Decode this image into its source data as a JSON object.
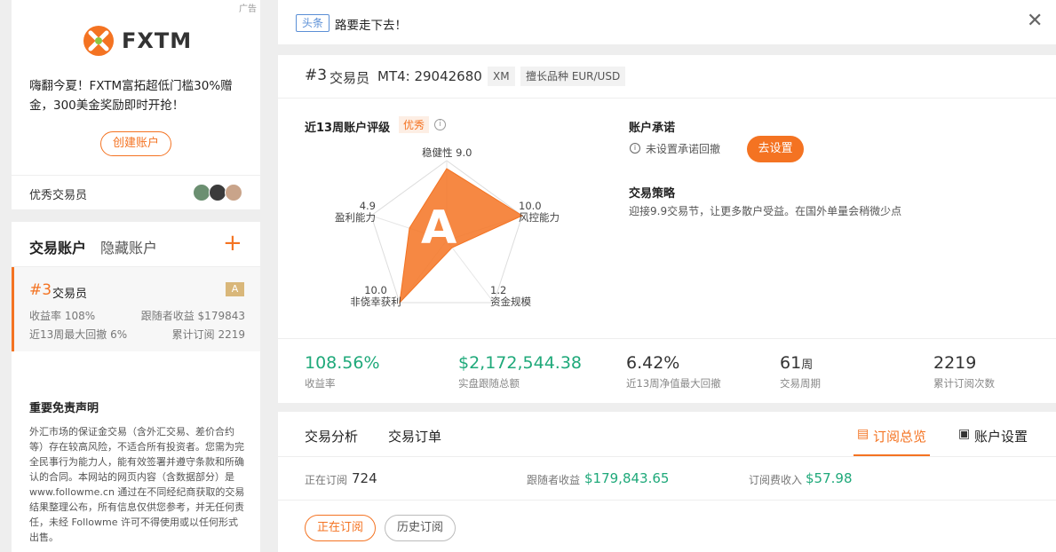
{
  "ad": {
    "badge": "广告",
    "brand": "FXTM",
    "text": "嗨翻今夏！FXTM富拓超低门槛30%赠金，300美金奖励即时开抢！",
    "cta": "创建账户"
  },
  "top_traders": {
    "label": "优秀交易员"
  },
  "accounts": {
    "tab_trading": "交易账户",
    "tab_hidden": "隐藏账户",
    "add_icon": "plus-icon",
    "item": {
      "rank": "#3",
      "name": "交易员",
      "grade": "A",
      "return_label": "收益率 108%",
      "follower_profit": "跟随者收益 $179843",
      "max_drawdown": "近13周最大回撤 6%",
      "subscriptions": "累计订阅 2219"
    }
  },
  "disclaimer": {
    "title": "重要免责声明",
    "body": "外汇市场的保证金交易（含外汇交易、差价合约等）存在较高风险，不适合所有投资者。您需为完全民事行为能力人，能有效签署并遵守条款和所确认的合同。本网站的网页内容（含数据部分）是 www.followme.cn 通过在不同经纪商获取的交易结果整理公布，所有信息仅供您参考，并无任何责任，未经 Followme 许可不得使用或以任何形式出售。"
  },
  "headline": {
    "tag": "头条",
    "text": "路要走下去！"
  },
  "trader": {
    "rank": "#3",
    "name": "交易员",
    "mt4": "MT4: 29042680",
    "broker": "XM",
    "specialty": "擅长品种 EUR/USD"
  },
  "rating": {
    "title": "近13周账户评级",
    "badge": "优秀",
    "grade": "A",
    "axes": [
      {
        "label": "稳健性",
        "value": "9.0"
      },
      {
        "label": "风控能力",
        "value": "10.0"
      },
      {
        "label": "资金规模",
        "value": "1.2"
      },
      {
        "label": "非侥幸获利",
        "value": "10.0"
      },
      {
        "label": "盈利能力",
        "value": "4.9"
      }
    ]
  },
  "promise": {
    "title": "账户承诺",
    "status": "未设置承诺回撤",
    "button": "去设置"
  },
  "strategy": {
    "title": "交易策略",
    "text": "迎接9.9交易节，让更多散户受益。在国外单量会稍微少点"
  },
  "stats": [
    {
      "value": "108.56%",
      "label": "收益率",
      "color": "#1fa97a"
    },
    {
      "value": "$2,172,544.38",
      "label": "实盘跟随总额",
      "color": "#1fa97a"
    },
    {
      "value": "6.42%",
      "label": "近13周净值最大回撤",
      "color": "#333333"
    },
    {
      "value": "61",
      "unit": "周",
      "label": "交易周期",
      "color": "#333333"
    },
    {
      "value": "2219",
      "label": "累计订阅次数",
      "color": "#333333"
    }
  ],
  "tabs": {
    "analysis": "交易分析",
    "orders": "交易订单",
    "subscription": "订阅总览",
    "settings": "账户设置"
  },
  "sub_stats": {
    "active_label": "正在订阅",
    "active_value": "724",
    "profit_label": "跟随者收益",
    "profit_value": "$179,843.65",
    "fee_label": "订阅费收入",
    "fee_value": "$57.98"
  },
  "sub_buttons": {
    "active": "正在订阅",
    "history": "历史订阅"
  }
}
